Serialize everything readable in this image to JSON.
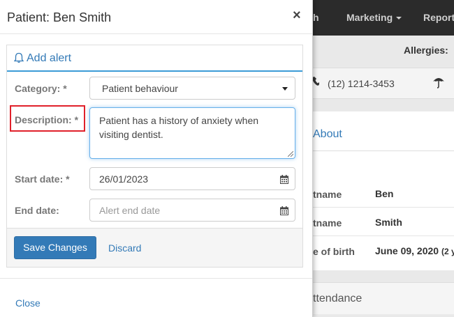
{
  "background": {
    "nav": {
      "items": [
        {
          "label": "h"
        },
        {
          "label": "Marketing",
          "has_caret": true
        },
        {
          "label": "Report"
        }
      ]
    },
    "allergies_label": "Allergies:",
    "phone": "(12) 1214-3453",
    "phone_icon": "phone-icon",
    "umbrella_icon": "umbrella-icon",
    "tab_about": "About",
    "rows": [
      {
        "label": "tname",
        "value": "Ben"
      },
      {
        "label": "tname",
        "value": "Smith"
      },
      {
        "label": "e of birth",
        "value": "June 09, 2020",
        "extra": "(2 y"
      }
    ],
    "attendance_label": "ttendance"
  },
  "modal": {
    "title": "Patient: Ben Smith",
    "close_glyph": "×",
    "panel": {
      "heading_icon": "bell-icon",
      "heading": "Add alert",
      "fields": {
        "category": {
          "label": "Category: *",
          "value": "Patient behaviour"
        },
        "description": {
          "label": "Description: *",
          "value": "Patient has a history of anxiety when visiting dentist."
        },
        "start_date": {
          "label": "Start date: *",
          "value": "26/01/2023"
        },
        "end_date": {
          "label": "End date:",
          "placeholder": "Alert end date"
        }
      },
      "save_label": "Save Changes",
      "discard_label": "Discard"
    },
    "footer_close": "Close"
  },
  "colors": {
    "accent": "#337ab7",
    "heading_underline": "#3b9bd6",
    "highlight": "#e0202a",
    "nav_bg": "#2b2b2b"
  }
}
